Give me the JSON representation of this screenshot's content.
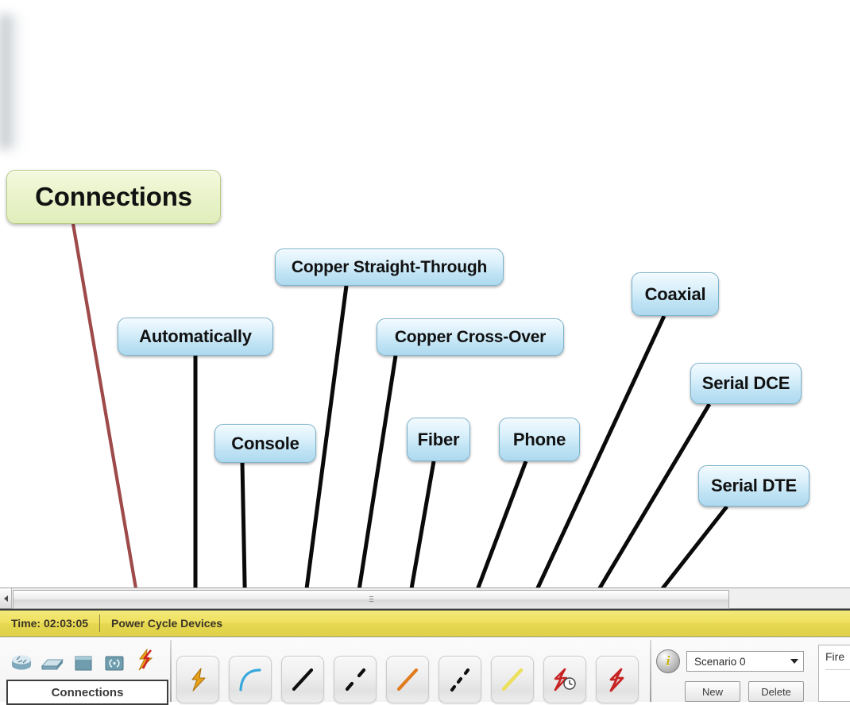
{
  "annotation": {
    "title_label": {
      "text": "Connections",
      "color": "#eaf3cb"
    },
    "callouts": [
      {
        "id": "automatically",
        "text": "Automatically"
      },
      {
        "id": "console",
        "text": "Console"
      },
      {
        "id": "copper-straight-through",
        "text": "Copper Straight-Through"
      },
      {
        "id": "copper-cross-over",
        "text": "Copper Cross-Over"
      },
      {
        "id": "fiber",
        "text": "Fiber"
      },
      {
        "id": "phone",
        "text": "Phone"
      },
      {
        "id": "coaxial",
        "text": "Coaxial"
      },
      {
        "id": "serial-dce",
        "text": "Serial DCE"
      },
      {
        "id": "serial-dte",
        "text": "Serial DTE"
      }
    ],
    "arrow_colors": {
      "pointer": "#0a0a0a",
      "title_pointer": "#9e4a4a"
    }
  },
  "app": {
    "statusbar": {
      "time_label": "Time: 02:03:05",
      "power_cycle_label": "Power Cycle Devices",
      "background": "#efe05e"
    },
    "device_panel": {
      "category_label": "Connections",
      "category_icons": [
        {
          "name": "router-icon",
          "title": "Routers"
        },
        {
          "name": "switch-icon",
          "title": "Switches"
        },
        {
          "name": "hub-icon",
          "title": "Hubs"
        },
        {
          "name": "wireless-icon",
          "title": "Wireless Devices"
        },
        {
          "name": "connections-icon",
          "title": "Connections"
        }
      ]
    },
    "connection_tools": [
      {
        "name": "automatic-connection-tool",
        "label": "Automatically",
        "icon": "lightning-gold-icon"
      },
      {
        "name": "console-connection-tool",
        "label": "Console",
        "icon": "blue-curve-icon"
      },
      {
        "name": "copper-straight-connection-tool",
        "label": "Copper Straight-Through",
        "icon": "black-line-icon"
      },
      {
        "name": "copper-cross-connection-tool",
        "label": "Copper Cross-Over",
        "icon": "black-dashed-icon"
      },
      {
        "name": "fiber-connection-tool",
        "label": "Fiber",
        "icon": "orange-line-icon"
      },
      {
        "name": "phone-connection-tool",
        "label": "Phone",
        "icon": "black-dotted-icon"
      },
      {
        "name": "coaxial-connection-tool",
        "label": "Coaxial",
        "icon": "yellow-line-icon"
      },
      {
        "name": "serial-dce-connection-tool",
        "label": "Serial DCE",
        "icon": "red-lightning-clock-icon"
      },
      {
        "name": "serial-dte-connection-tool",
        "label": "Serial DTE",
        "icon": "red-lightning-icon"
      }
    ],
    "scenario_panel": {
      "selected_scenario": "Scenario 0",
      "new_button": "New",
      "delete_button": "Delete"
    },
    "fire_panel": {
      "label": "Fire"
    }
  }
}
